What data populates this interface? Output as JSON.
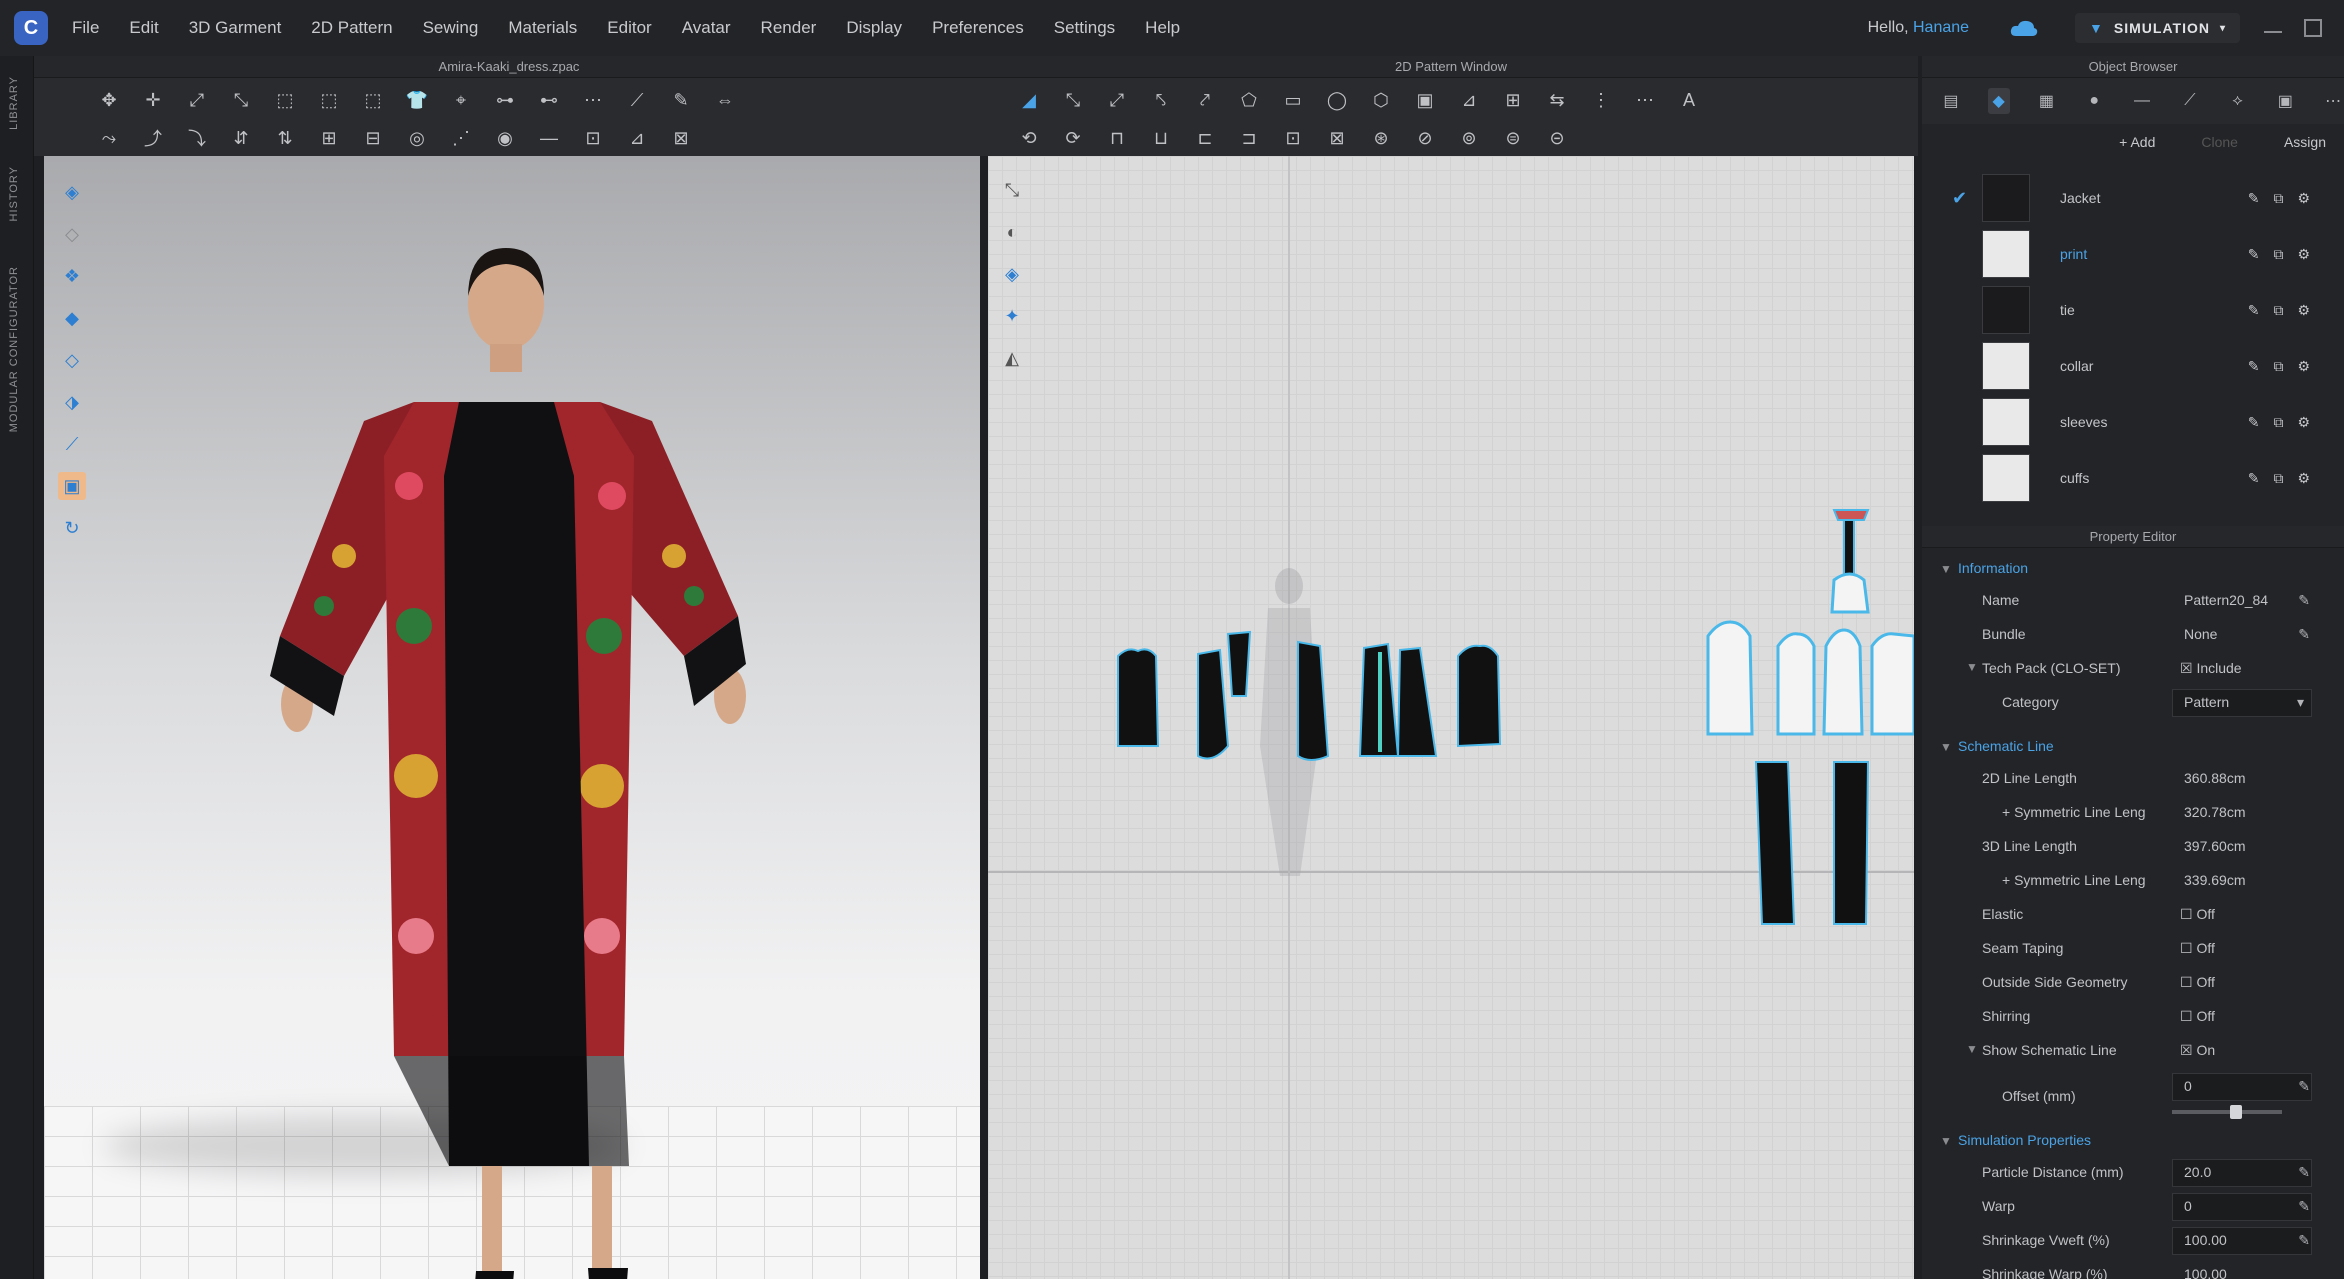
{
  "menubar": {
    "logo": "C",
    "items": [
      "File",
      "Edit",
      "3D Garment",
      "2D Pattern",
      "Sewing",
      "Materials",
      "Editor",
      "Avatar",
      "Render",
      "Display",
      "Preferences",
      "Settings",
      "Help"
    ],
    "greeting": "Hello,",
    "username": "Hanane",
    "simulation_label": "SIMULATION"
  },
  "panel_titles": {
    "viewport3d": "Amira-Kaaki_dress.zpac",
    "viewport2d": "2D Pattern Window",
    "object_browser": "Object Browser",
    "property_editor": "Property Editor"
  },
  "left_strip": {
    "tabs": [
      "LIBRARY",
      "HISTORY",
      "MODULAR CONFIGURATOR"
    ]
  },
  "object_browser": {
    "add_label": "+ Add",
    "copy_label": "Clone",
    "assign_label": "Assign",
    "fabrics": [
      {
        "name": "Jacket",
        "dark": true,
        "checked": true,
        "selected": false
      },
      {
        "name": "print",
        "dark": false,
        "checked": false,
        "selected": true
      },
      {
        "name": "tie",
        "dark": true,
        "checked": false,
        "selected": false
      },
      {
        "name": "collar",
        "dark": false,
        "checked": false,
        "selected": false
      },
      {
        "name": "sleeves",
        "dark": false,
        "checked": false,
        "selected": false
      },
      {
        "name": "cuffs",
        "dark": false,
        "checked": false,
        "selected": false
      }
    ]
  },
  "property_editor": {
    "sections": {
      "information": "Information",
      "schematic_line": "Schematic Line",
      "simulation": "Simulation Properties"
    },
    "rows": {
      "name_label": "Name",
      "name_value": "Pattern20_84",
      "bundle_label": "Bundle",
      "bundle_value": "None",
      "techpack_label": "Tech Pack (CLO-SET)",
      "techpack_value": "Include",
      "category_label": "Category",
      "category_value": "Pattern",
      "len2d_label": "2D Line Length",
      "len2d_value": "360.88cm",
      "sym2d_label": "+ Symmetric Line Leng",
      "sym2d_value": "320.78cm",
      "len3d_label": "3D Line Length",
      "len3d_value": "397.60cm",
      "sym3d_label": "+ Symmetric Line Leng",
      "sym3d_value": "339.69cm",
      "elastic_label": "Elastic",
      "elastic_value": "Off",
      "seamtaping_label": "Seam Taping",
      "seamtaping_value": "Off",
      "outside_label": "Outside Side Geometry",
      "outside_value": "Off",
      "shirring_label": "Shirring",
      "shirring_value": "Off",
      "showschem_label": "Show Schematic Line",
      "showschem_value": "On",
      "offset_label": "Offset (mm)",
      "offset_value": "0",
      "particle_label": "Particle Distance (mm)",
      "particle_value": "20.0",
      "warp_label": "Warp",
      "warp_value": "0",
      "shrink_label": "Shrinkage Vweft (%)",
      "shrink_value": "100.00",
      "shrink2_label": "Shrinkage Warp (%)",
      "shrink2_value": "100.00"
    }
  },
  "colors": {
    "accent": "#4aa3e6",
    "panel": "#2a2b2f",
    "viewport_bg": "#dadbdd",
    "pattern_outline": "#4ab8e8",
    "garment_dark": "#101012",
    "embroidery_red": "#b3262b"
  }
}
